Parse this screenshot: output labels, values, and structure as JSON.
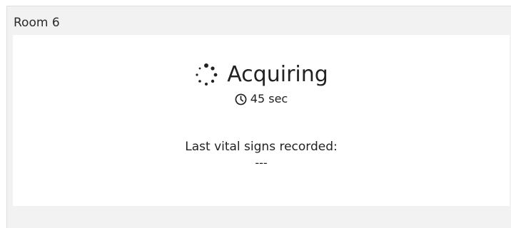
{
  "panel": {
    "title": "Room 6"
  },
  "status": {
    "icon": "loading-spinner-icon",
    "text": "Acquiring",
    "timer_icon": "clock-icon",
    "timer_text": "45 sec"
  },
  "vitals": {
    "label": "Last vital signs recorded:",
    "value": "---"
  }
}
